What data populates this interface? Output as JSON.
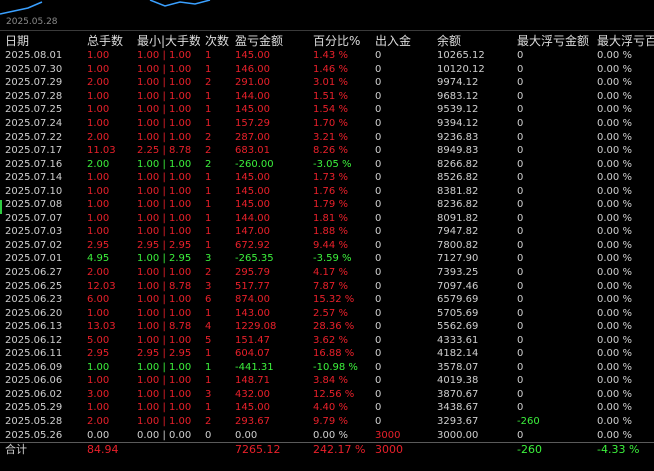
{
  "chart_strip": {
    "date": "2025.05.28"
  },
  "colors": {
    "profit": "#e8202a",
    "loss": "#3cf03c",
    "neutral": "#cfcfcf",
    "background": "#000000"
  },
  "headers": [
    "日期",
    "总手数",
    "最小|大手数",
    "次数",
    "盈亏金额",
    "百分比%",
    "出入金",
    "余额",
    "最大浮亏金额",
    "最大浮亏百分"
  ],
  "rows": [
    {
      "cells": [
        "2025.08.01",
        "1.00",
        "1.00 | 1.00",
        "1",
        "145.00",
        "1.43 %",
        "0",
        "10265.12",
        "0",
        "0.00 %"
      ],
      "tone": "pos"
    },
    {
      "cells": [
        "2025.07.30",
        "1.00",
        "1.00 | 1.00",
        "1",
        "146.00",
        "1.46 %",
        "0",
        "10120.12",
        "0",
        "0.00 %"
      ],
      "tone": "pos"
    },
    {
      "cells": [
        "2025.07.29",
        "2.00",
        "1.00 | 1.00",
        "2",
        "291.00",
        "3.01 %",
        "0",
        "9974.12",
        "0",
        "0.00 %"
      ],
      "tone": "pos"
    },
    {
      "cells": [
        "2025.07.28",
        "1.00",
        "1.00 | 1.00",
        "1",
        "144.00",
        "1.51 %",
        "0",
        "9683.12",
        "0",
        "0.00 %"
      ],
      "tone": "pos"
    },
    {
      "cells": [
        "2025.07.25",
        "1.00",
        "1.00 | 1.00",
        "1",
        "145.00",
        "1.54 %",
        "0",
        "9539.12",
        "0",
        "0.00 %"
      ],
      "tone": "pos"
    },
    {
      "cells": [
        "2025.07.24",
        "1.00",
        "1.00 | 1.00",
        "1",
        "157.29",
        "1.70 %",
        "0",
        "9394.12",
        "0",
        "0.00 %"
      ],
      "tone": "pos"
    },
    {
      "cells": [
        "2025.07.22",
        "2.00",
        "1.00 | 1.00",
        "2",
        "287.00",
        "3.21 %",
        "0",
        "9236.83",
        "0",
        "0.00 %"
      ],
      "tone": "pos"
    },
    {
      "cells": [
        "2025.07.17",
        "11.03",
        "2.25 | 8.78",
        "2",
        "683.01",
        "8.26 %",
        "0",
        "8949.83",
        "0",
        "0.00 %"
      ],
      "tone": "pos"
    },
    {
      "cells": [
        "2025.07.16",
        "2.00",
        "1.00 | 1.00",
        "2",
        "-260.00",
        "-3.05 %",
        "0",
        "8266.82",
        "0",
        "0.00 %"
      ],
      "tone": "neg"
    },
    {
      "cells": [
        "2025.07.14",
        "1.00",
        "1.00 | 1.00",
        "1",
        "145.00",
        "1.73 %",
        "0",
        "8526.82",
        "0",
        "0.00 %"
      ],
      "tone": "pos"
    },
    {
      "cells": [
        "2025.07.10",
        "1.00",
        "1.00 | 1.00",
        "1",
        "145.00",
        "1.76 %",
        "0",
        "8381.82",
        "0",
        "0.00 %"
      ],
      "tone": "pos"
    },
    {
      "cells": [
        "2025.07.08",
        "1.00",
        "1.00 | 1.00",
        "1",
        "145.00",
        "1.79 %",
        "0",
        "8236.82",
        "0",
        "0.00 %"
      ],
      "tone": "pos"
    },
    {
      "cells": [
        "2025.07.07",
        "1.00",
        "1.00 | 1.00",
        "1",
        "144.00",
        "1.81 %",
        "0",
        "8091.82",
        "0",
        "0.00 %"
      ],
      "tone": "pos"
    },
    {
      "cells": [
        "2025.07.03",
        "1.00",
        "1.00 | 1.00",
        "1",
        "147.00",
        "1.88 %",
        "0",
        "7947.82",
        "0",
        "0.00 %"
      ],
      "tone": "pos"
    },
    {
      "cells": [
        "2025.07.02",
        "2.95",
        "2.95 | 2.95",
        "1",
        "672.92",
        "9.44 %",
        "0",
        "7800.82",
        "0",
        "0.00 %"
      ],
      "tone": "pos"
    },
    {
      "cells": [
        "2025.07.01",
        "4.95",
        "1.00 | 2.95",
        "3",
        "-265.35",
        "-3.59 %",
        "0",
        "7127.90",
        "0",
        "0.00 %"
      ],
      "tone": "neg"
    },
    {
      "cells": [
        "2025.06.27",
        "2.00",
        "1.00 | 1.00",
        "2",
        "295.79",
        "4.17 %",
        "0",
        "7393.25",
        "0",
        "0.00 %"
      ],
      "tone": "pos"
    },
    {
      "cells": [
        "2025.06.25",
        "12.03",
        "1.00 | 8.78",
        "3",
        "517.77",
        "7.87 %",
        "0",
        "7097.46",
        "0",
        "0.00 %"
      ],
      "tone": "pos"
    },
    {
      "cells": [
        "2025.06.23",
        "6.00",
        "1.00 | 1.00",
        "6",
        "874.00",
        "15.32 %",
        "0",
        "6579.69",
        "0",
        "0.00 %"
      ],
      "tone": "pos"
    },
    {
      "cells": [
        "2025.06.20",
        "1.00",
        "1.00 | 1.00",
        "1",
        "143.00",
        "2.57 %",
        "0",
        "5705.69",
        "0",
        "0.00 %"
      ],
      "tone": "pos"
    },
    {
      "cells": [
        "2025.06.13",
        "13.03",
        "1.00 | 8.78",
        "4",
        "1229.08",
        "28.36 %",
        "0",
        "5562.69",
        "0",
        "0.00 %"
      ],
      "tone": "pos"
    },
    {
      "cells": [
        "2025.06.12",
        "5.00",
        "1.00 | 1.00",
        "5",
        "151.47",
        "3.62 %",
        "0",
        "4333.61",
        "0",
        "0.00 %"
      ],
      "tone": "pos"
    },
    {
      "cells": [
        "2025.06.11",
        "2.95",
        "2.95 | 2.95",
        "1",
        "604.07",
        "16.88 %",
        "0",
        "4182.14",
        "0",
        "0.00 %"
      ],
      "tone": "pos"
    },
    {
      "cells": [
        "2025.06.09",
        "1.00",
        "1.00 | 1.00",
        "1",
        "-441.31",
        "-10.98 %",
        "0",
        "3578.07",
        "0",
        "0.00 %"
      ],
      "tone": "neg"
    },
    {
      "cells": [
        "2025.06.06",
        "1.00",
        "1.00 | 1.00",
        "1",
        "148.71",
        "3.84 %",
        "0",
        "4019.38",
        "0",
        "0.00 %"
      ],
      "tone": "pos"
    },
    {
      "cells": [
        "2025.06.02",
        "3.00",
        "1.00 | 1.00",
        "3",
        "432.00",
        "12.56 %",
        "0",
        "3870.67",
        "0",
        "0.00 %"
      ],
      "tone": "pos"
    },
    {
      "cells": [
        "2025.05.29",
        "1.00",
        "1.00 | 1.00",
        "1",
        "145.00",
        "4.40 %",
        "0",
        "3438.67",
        "0",
        "0.00 %"
      ],
      "tone": "pos"
    },
    {
      "cells": [
        "2025.05.28",
        "2.00",
        "1.00 | 1.00",
        "2",
        "293.67",
        "9.79 %",
        "0",
        "3293.67",
        "-260",
        "0.00 %"
      ],
      "tone": "pos"
    },
    {
      "cells": [
        "2025.05.26",
        "0.00",
        "0.00 | 0.00",
        "0",
        "0.00",
        "0.00 %",
        "3000",
        "3000.00",
        "0",
        "0.00 %"
      ],
      "tone": "zero"
    }
  ],
  "total": {
    "cells": [
      "合计",
      "84.94",
      "",
      "",
      "7265.12",
      "242.17 %",
      "3000",
      "",
      "-260",
      "-4.33 %"
    ]
  }
}
